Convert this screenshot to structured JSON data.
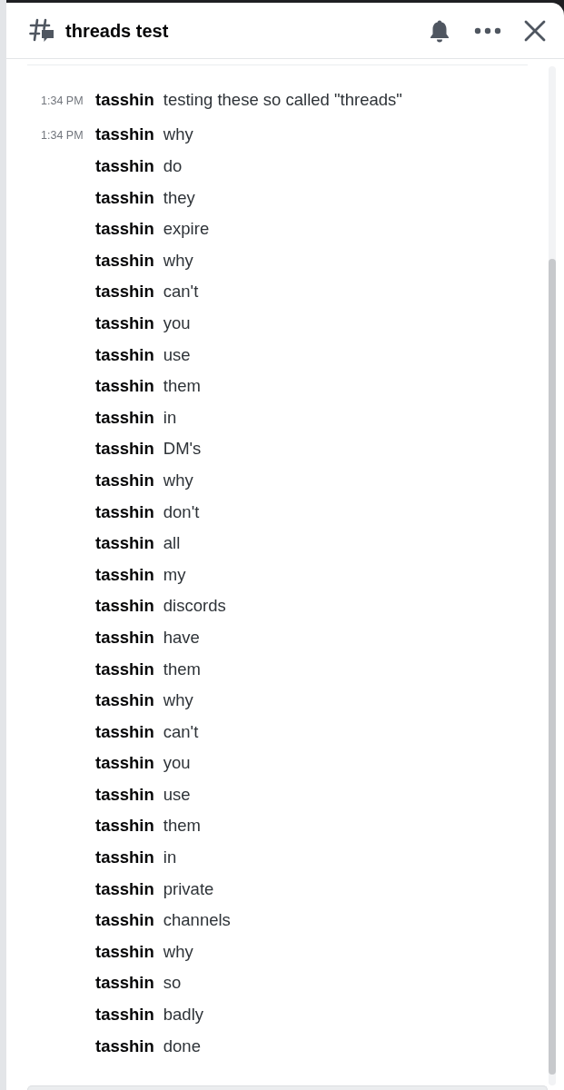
{
  "thread": {
    "title": "threads test"
  },
  "messages": [
    {
      "time": "1:34 PM",
      "author": "tasshin",
      "text": "testing these so called \"threads\""
    },
    {
      "time": "1:34 PM",
      "author": "tasshin",
      "text": "why"
    },
    {
      "author": "tasshin",
      "text": "do"
    },
    {
      "author": "tasshin",
      "text": "they"
    },
    {
      "author": "tasshin",
      "text": "expire"
    },
    {
      "author": "tasshin",
      "text": "why"
    },
    {
      "author": "tasshin",
      "text": "can't"
    },
    {
      "author": "tasshin",
      "text": "you"
    },
    {
      "author": "tasshin",
      "text": "use"
    },
    {
      "author": "tasshin",
      "text": "them"
    },
    {
      "author": "tasshin",
      "text": "in"
    },
    {
      "author": "tasshin",
      "text": "DM's"
    },
    {
      "author": "tasshin",
      "text": "why"
    },
    {
      "author": "tasshin",
      "text": "don't"
    },
    {
      "author": "tasshin",
      "text": "all"
    },
    {
      "author": "tasshin",
      "text": "my"
    },
    {
      "author": "tasshin",
      "text": "discords"
    },
    {
      "author": "tasshin",
      "text": "have"
    },
    {
      "author": "tasshin",
      "text": "them"
    },
    {
      "author": "tasshin",
      "text": "why"
    },
    {
      "author": "tasshin",
      "text": "can't"
    },
    {
      "author": "tasshin",
      "text": "you"
    },
    {
      "author": "tasshin",
      "text": "use"
    },
    {
      "author": "tasshin",
      "text": "them"
    },
    {
      "author": "tasshin",
      "text": "in"
    },
    {
      "author": "tasshin",
      "text": "private"
    },
    {
      "author": "tasshin",
      "text": "channels"
    },
    {
      "author": "tasshin",
      "text": "why"
    },
    {
      "author": "tasshin",
      "text": "so"
    },
    {
      "author": "tasshin",
      "text": "badly"
    },
    {
      "author": "tasshin",
      "text": "done"
    }
  ]
}
